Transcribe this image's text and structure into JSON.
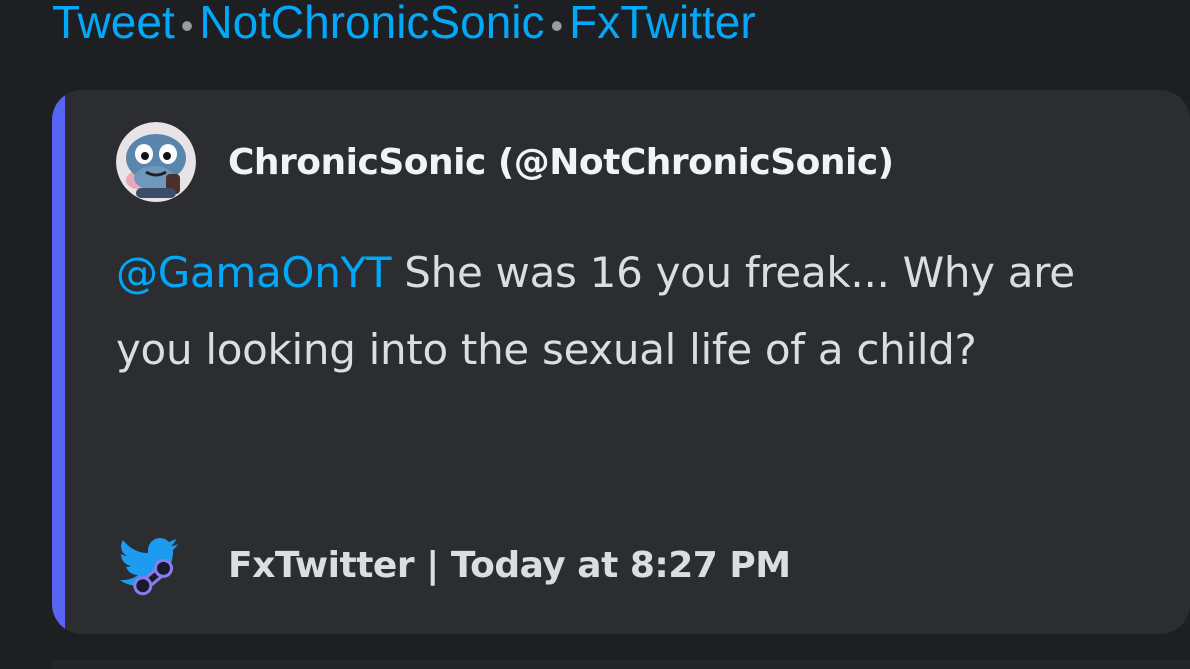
{
  "header": {
    "link_tweet": "Tweet",
    "separator": "•",
    "link_author": "NotChronicSonic",
    "link_site": "FxTwitter"
  },
  "embed": {
    "accent_color": "#5865f2",
    "author": {
      "name": "ChronicSonic (@NotChronicSonic)",
      "avatar_icon": "cartoon-hedgehog-avatar"
    },
    "tweet": {
      "mention": "@GamaOnYT",
      "text": " She was 16 you freak... Why are you looking into the sexual life of a child?"
    },
    "footer": {
      "icon": "fxtwitter-bird-wrench-icon",
      "text": "FxTwitter | Today at 8:27 PM"
    }
  },
  "colors": {
    "background": "#1e1f22",
    "embed_background": "#2b2d31",
    "link": "#00a8fc",
    "text": "#dbdee1"
  }
}
